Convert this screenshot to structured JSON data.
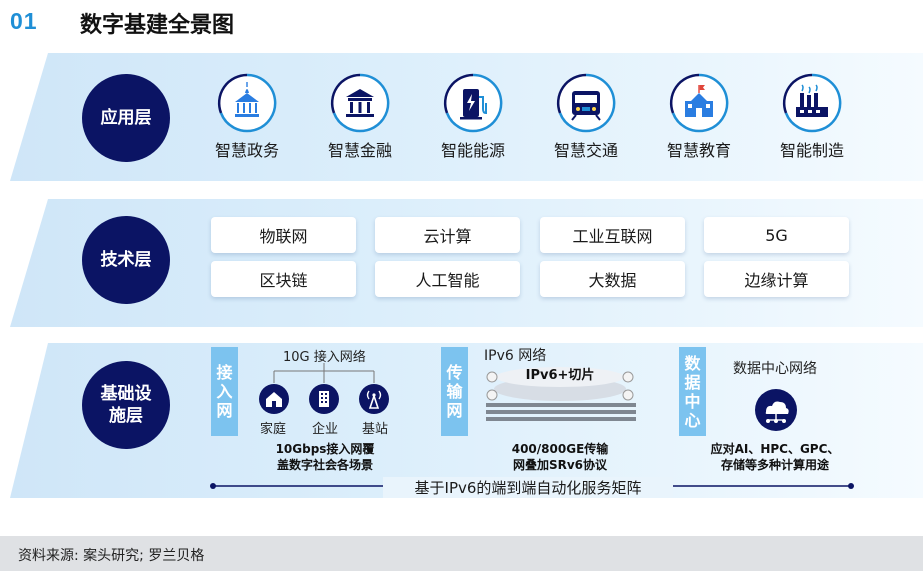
{
  "header": {
    "number": "01",
    "title": "数字基建全景图"
  },
  "layers": {
    "application": "应用层",
    "technology": "技术层",
    "infrastructure_line1": "基础设",
    "infrastructure_line2": "施层"
  },
  "applications": [
    {
      "label": "智慧政务",
      "icon": "government-building-icon"
    },
    {
      "label": "智慧金融",
      "icon": "bank-icon"
    },
    {
      "label": "智能能源",
      "icon": "charging-station-icon"
    },
    {
      "label": "智慧交通",
      "icon": "train-icon"
    },
    {
      "label": "智慧教育",
      "icon": "school-icon"
    },
    {
      "label": "智能制造",
      "icon": "factory-icon"
    }
  ],
  "technologies": [
    "物联网",
    "云计算",
    "工业互联网",
    "5G",
    "区块链",
    "人工智能",
    "大数据",
    "边缘计算"
  ],
  "infrastructure": {
    "access": {
      "tab": [
        "接",
        "入",
        "网"
      ],
      "title": "10G 接入网络",
      "nodes": [
        "家庭",
        "企业",
        "基站"
      ],
      "note_line1": "10Gbps接入网覆",
      "note_line2": "盖数字社会各场景"
    },
    "transport": {
      "tab": [
        "传",
        "输",
        "网"
      ],
      "title": "IPv6 网络",
      "slice_label": "IPv6+切片",
      "note_line1": "400/800GE传输",
      "note_line2": "网叠加SRv6协议"
    },
    "datacenter": {
      "tab": [
        "数",
        "据",
        "中",
        "心"
      ],
      "title": "数据中心网络",
      "note_line1": "应对AI、HPC、GPC、",
      "note_line2": "存储等多种计算用途"
    },
    "matrix": "基于IPv6的端到端自动化服务矩阵"
  },
  "footer": "资料来源: 案头研究; 罗兰贝格",
  "colors": {
    "navy": "#0b1464",
    "accent_blue": "#1f8fd6",
    "tab_blue": "#7cc3ef"
  }
}
